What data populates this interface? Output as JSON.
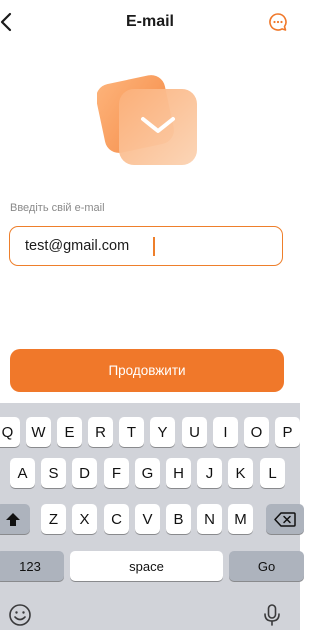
{
  "header": {
    "title": "E-mail"
  },
  "form": {
    "label": "Введіть свій e-mail",
    "email_value": "test@gmail.com"
  },
  "actions": {
    "continue_label": "Продовжити"
  },
  "keyboard": {
    "row1": [
      "Q",
      "W",
      "E",
      "R",
      "T",
      "Y",
      "U",
      "I",
      "O",
      "P"
    ],
    "row2": [
      "A",
      "S",
      "D",
      "F",
      "G",
      "H",
      "J",
      "K",
      "L"
    ],
    "row3": [
      "Z",
      "X",
      "C",
      "V",
      "B",
      "N",
      "M"
    ],
    "numbers_label": "123",
    "space_label": "space",
    "go_label": "Go"
  },
  "icons": {
    "back": "chevron-left-icon",
    "support": "chat-bubble-icon",
    "shift": "shift-arrow-icon",
    "backspace": "backspace-icon",
    "emoji": "emoji-icon",
    "mic": "microphone-icon",
    "hero": "envelope-icon"
  },
  "colors": {
    "accent": "#F0782A",
    "accent_light": "#FDBA85",
    "keyboard_bg": "#D1D3D9",
    "key_dark": "#ADB3BD"
  }
}
